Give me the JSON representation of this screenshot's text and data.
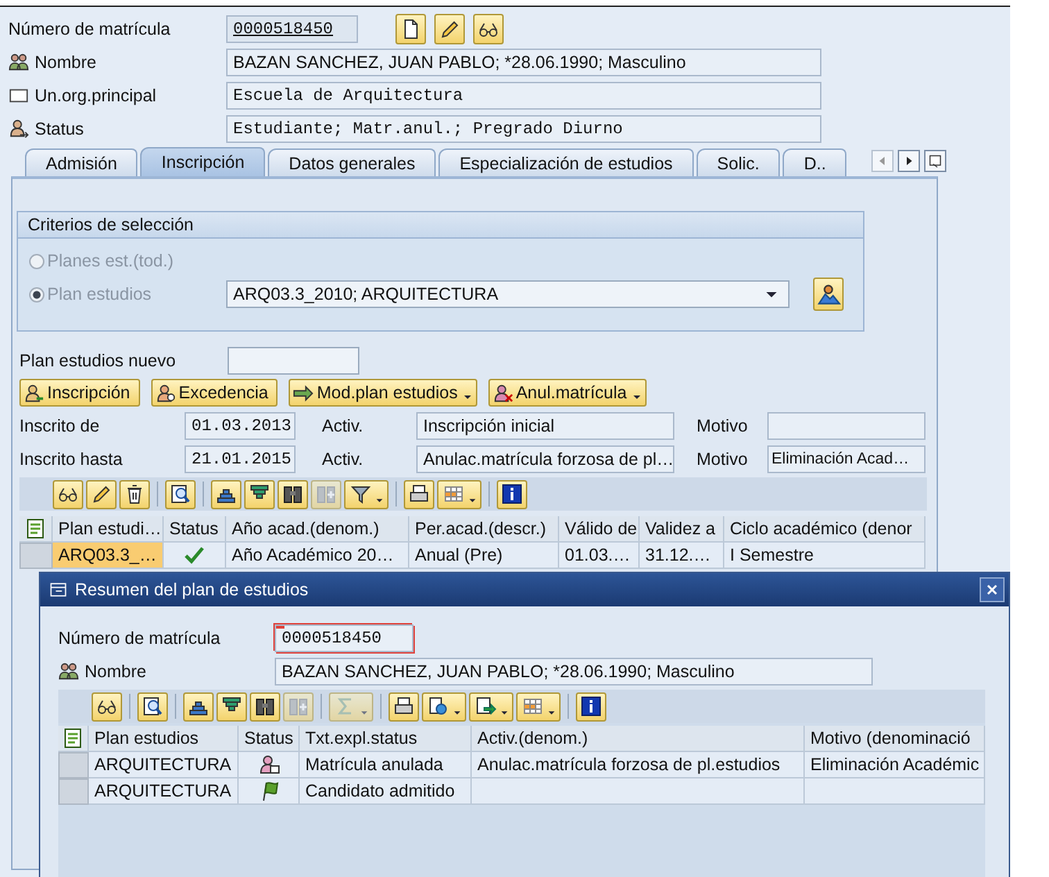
{
  "header": {
    "fields": [
      {
        "label": "Número de matrícula",
        "value": "0000518450",
        "kind": "number"
      },
      {
        "label": "Nombre",
        "value": "BAZAN SANCHEZ, JUAN PABLO; *28.06.1990; Masculino",
        "kind": "person"
      },
      {
        "label": "Un.org.principal",
        "value": "Escuela de Arquitectura",
        "kind": "org"
      },
      {
        "label": "Status",
        "value": "Estudiante; Matr.anul.; Pregrado Diurno",
        "kind": "status"
      }
    ],
    "toolbar": [
      {
        "kind": "create"
      },
      {
        "kind": "change"
      },
      {
        "kind": "display"
      }
    ]
  },
  "tabs": [
    {
      "label": "Admisión",
      "selected": false
    },
    {
      "label": "Inscripción",
      "selected": true
    },
    {
      "label": "Datos generales",
      "selected": false
    },
    {
      "label": "Especialización de estudios",
      "selected": false
    },
    {
      "label": "Solic.",
      "selected": false
    },
    {
      "label": "D..",
      "selected": false
    }
  ],
  "tab_nav": [
    {
      "kind": "tab-left",
      "disabled": true
    },
    {
      "kind": "tab-right",
      "disabled": false
    },
    {
      "kind": "tab-list",
      "disabled": false
    }
  ],
  "selection_group": {
    "title": "Criterios de selección",
    "options": [
      {
        "label": "Planes est.(tod.)",
        "selected": false,
        "disabled": true
      },
      {
        "label": "Plan estudios",
        "selected": true,
        "disabled": true
      }
    ],
    "plan_value": "ARQ03.3_2010; ARQUITECTURA"
  },
  "new_plan": {
    "label": "Plan estudios nuevo"
  },
  "actions": [
    {
      "label": "Inscripción",
      "kind": "enroll",
      "dropdown": false
    },
    {
      "label": "Excedencia",
      "kind": "leave",
      "dropdown": false
    },
    {
      "label": "Mod.plan estudios",
      "kind": "change-plan",
      "dropdown": true
    },
    {
      "label": "Anul.matrícula",
      "kind": "cancel",
      "dropdown": true
    }
  ],
  "enrollment": [
    {
      "label": "Inscrito de",
      "date": "01.03.2013",
      "activity_label": "Activ.",
      "activity": "Inscripción inicial",
      "reason_label": "Motivo"
    },
    {
      "label": "Inscrito hasta",
      "date": "21.01.2015",
      "activity_label": "Activ.",
      "activity": "Anulac.matrícula forzosa de pl…",
      "reason_label": "Motivo",
      "reason": "Eliminación Acad…"
    }
  ],
  "table": {
    "toolbar": [
      [
        {
          "kind": "display",
          "disabled": false,
          "dropdown": false
        },
        {
          "kind": "change",
          "disabled": false,
          "dropdown": false
        },
        {
          "kind": "delete",
          "disabled": false,
          "dropdown": false
        }
      ],
      [
        {
          "kind": "details",
          "disabled": false,
          "dropdown": false
        }
      ],
      [
        {
          "kind": "sort-asc",
          "disabled": false,
          "dropdown": false
        },
        {
          "kind": "sort-desc",
          "disabled": false,
          "dropdown": false
        },
        {
          "kind": "find",
          "disabled": false,
          "dropdown": false
        },
        {
          "kind": "find-next",
          "disabled": true,
          "dropdown": false
        },
        {
          "kind": "filter",
          "disabled": false,
          "dropdown": true
        }
      ],
      [
        {
          "kind": "print",
          "disabled": false,
          "dropdown": false
        },
        {
          "kind": "layout",
          "disabled": false,
          "dropdown": true
        }
      ],
      [
        {
          "kind": "info",
          "disabled": false,
          "dropdown": false
        }
      ]
    ],
    "columns": [
      "Plan estudi…",
      "Status",
      "Año acad.(denom.)",
      "Per.acad.(descr.)",
      "Válido de",
      "Validez a",
      "Ciclo académico (denor"
    ],
    "rows": [
      {
        "selected": true,
        "kind": "check",
        "cells": [
          "ARQ03.3_…",
          "",
          "Año Académico 20…",
          "Anual (Pre)",
          "01.03.…",
          "31.12.…",
          "I Semestre"
        ]
      }
    ]
  },
  "dialog": {
    "title": "Resumen del plan de estudios",
    "fields": [
      {
        "label": "Número de matrícula",
        "value": "0000518450",
        "kind": "number"
      },
      {
        "label": "Nombre",
        "value": "BAZAN SANCHEZ, JUAN PABLO; *28.06.1990; Masculino",
        "kind": "person"
      }
    ],
    "toolbar": [
      [
        {
          "kind": "display",
          "disabled": false,
          "dropdown": false
        }
      ],
      [
        {
          "kind": "details",
          "disabled": false,
          "dropdown": false
        }
      ],
      [
        {
          "kind": "sort-asc",
          "disabled": false,
          "dropdown": false
        },
        {
          "kind": "sort-desc",
          "disabled": false,
          "dropdown": false
        },
        {
          "kind": "find",
          "disabled": false,
          "dropdown": false
        },
        {
          "kind": "find-next",
          "disabled": true,
          "dropdown": false
        }
      ],
      [
        {
          "kind": "sum",
          "disabled": true,
          "dropdown": true
        }
      ],
      [
        {
          "kind": "print",
          "disabled": false,
          "dropdown": false
        },
        {
          "kind": "views",
          "disabled": false,
          "dropdown": true
        },
        {
          "kind": "export",
          "disabled": false,
          "dropdown": true
        },
        {
          "kind": "layout",
          "disabled": false,
          "dropdown": true
        }
      ],
      [
        {
          "kind": "info",
          "disabled": false,
          "dropdown": false
        }
      ]
    ],
    "columns": [
      "Plan estudios",
      "Status",
      "Txt.expl.status",
      "Activ.(denom.)",
      "Motivo (denominació"
    ],
    "rows": [
      {
        "kind": "cancelled",
        "cells": [
          "ARQUITECTURA",
          "",
          "Matrícula anulada",
          "Anulac.matrícula forzosa de pl.estudios",
          "Eliminación Académic"
        ]
      },
      {
        "kind": "flag",
        "cells": [
          "ARQUITECTURA",
          "",
          "Candidato admitido",
          "",
          ""
        ]
      }
    ]
  }
}
